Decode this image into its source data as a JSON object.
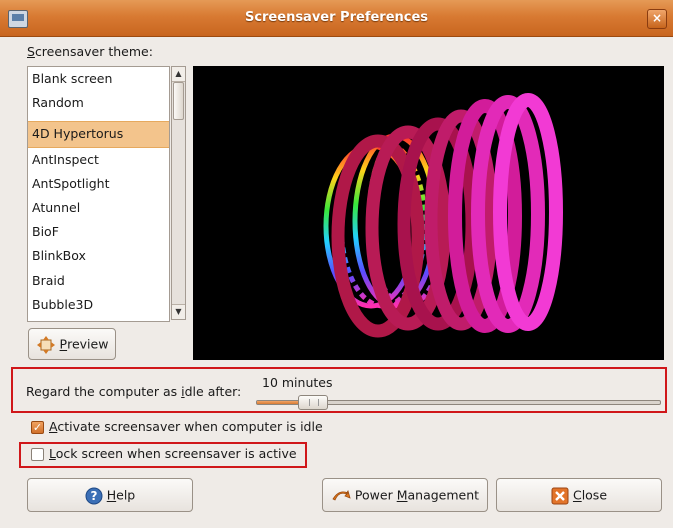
{
  "window": {
    "title": "Screensaver Preferences"
  },
  "theme_section": {
    "label_first": "S",
    "label_rest": "creensaver theme:"
  },
  "themes": {
    "special": [
      "Blank screen",
      "Random"
    ],
    "items": [
      "4D Hypertorus",
      "AntInspect",
      "AntSpotlight",
      "Atunnel",
      "BioF",
      "BlinkBox",
      "Braid",
      "Bubble3D"
    ],
    "selected": "4D Hypertorus"
  },
  "preview_button": {
    "pre": "",
    "mnemonic": "P",
    "post": "review"
  },
  "idle": {
    "label_pre": "Regard the computer as ",
    "label_mnemonic": "i",
    "label_post": "dle after:",
    "value_text": "10 minutes",
    "slider_fraction": 0.1
  },
  "activate": {
    "mnemonic": "A",
    "rest": "ctivate screensaver when computer is idle",
    "checked": true
  },
  "lock": {
    "mnemonic": "L",
    "rest": "ock screen when screensaver is active",
    "checked": false
  },
  "buttons": {
    "help": {
      "mnemonic": "H",
      "rest": "elp"
    },
    "power": {
      "pre": "Power ",
      "mnemonic": "M",
      "post": "anagement"
    },
    "close": {
      "mnemonic": "C",
      "rest": "lose"
    }
  },
  "icons": {
    "window": "display-icon",
    "close": "close-icon",
    "help": "help-icon",
    "power": "power-icon",
    "preview": "preview-icon",
    "close_btn": "close-x-icon"
  },
  "colors": {
    "titlebar": "#d87a32",
    "selection": "#f3c48c",
    "highlight_box": "#d0171a",
    "background": "#efebe7"
  }
}
